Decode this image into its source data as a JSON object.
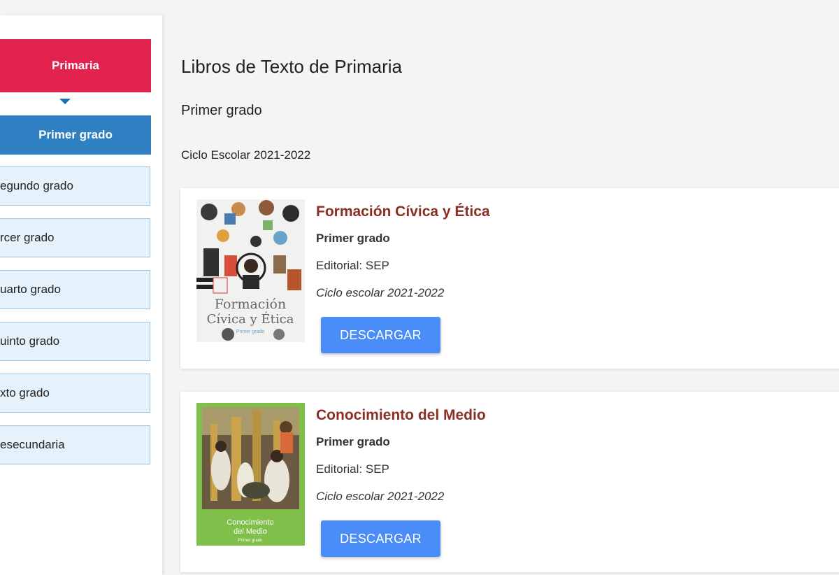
{
  "sidebar": {
    "level_label": "Primaria",
    "active_grade": "Primer grado",
    "grades": [
      "egundo grado",
      "rcer grado",
      "uarto grado",
      "uinto grado",
      "xto grado",
      "esecundaria"
    ]
  },
  "main": {
    "page_title": "Libros de Texto de Primaria",
    "grade_title": "Primer grado",
    "cycle_title": "Ciclo Escolar 2021-2022",
    "books": [
      {
        "title": "Formación Cívica y Ética",
        "grade": "Primer grado",
        "editorial": "Editorial: SEP",
        "cycle": "Ciclo escolar 2021-2022",
        "button": "DESCARGAR",
        "cover_title_1": "Formación",
        "cover_title_2": "Cívica y Ética",
        "cover_sub": "Primer grado"
      },
      {
        "title": "Conocimiento del Medio",
        "grade": "Primer grado",
        "editorial": "Editorial: SEP",
        "cycle": "Ciclo escolar 2021-2022",
        "button": "DESCARGAR",
        "cover_title_1": "Conocimiento",
        "cover_title_2": "del Medio",
        "cover_sub": "Primer grado"
      }
    ]
  },
  "colors": {
    "level": "#e2224f",
    "active_grade": "#2f7fc3",
    "grade_bg": "#e6f2fb",
    "book_title": "#8b2e23",
    "button": "#4b8df8"
  }
}
